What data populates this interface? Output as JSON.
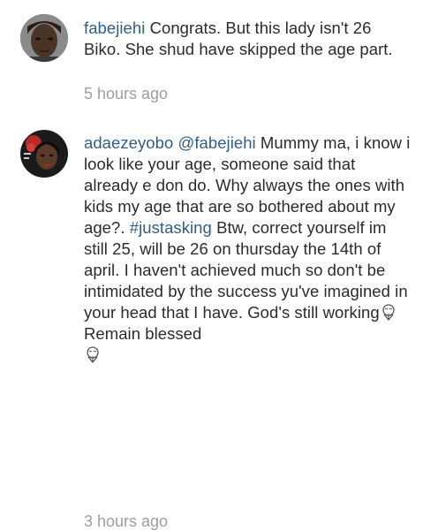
{
  "comments": [
    {
      "username": "fabejiehi",
      "text": "Congrats. But this lady isn't 26 Biko. She shud  have skipped the age part.",
      "timestamp": "5 hours ago",
      "avatar_icon": "user-avatar-fabejiehi"
    },
    {
      "username": "adaezeyobo",
      "mention": "@fabejiehi",
      "text_part1": "Mummy ma, i know i look like your age, someone said that already e don do. Why always the ones with kids my age that are so bothered about my age?.",
      "hashtag": "#justasking",
      "text_part2": "Btw, correct yourself im still 25, will be 26 on thursday the 14th of april.  I haven't achieved much so don't be intimidated by the success yu've imagined in your head that I have. God's still working",
      "text_part3": "Remain blessed",
      "emoji_icon": "praying-face-emoji",
      "timestamp": "3 hours ago",
      "avatar_icon": "user-avatar-adaezeyobo"
    }
  ],
  "colors": {
    "username": "#2f5f86",
    "text": "#2b2b2b",
    "timestamp": "#9e9e9e",
    "background": "#ffffff"
  }
}
